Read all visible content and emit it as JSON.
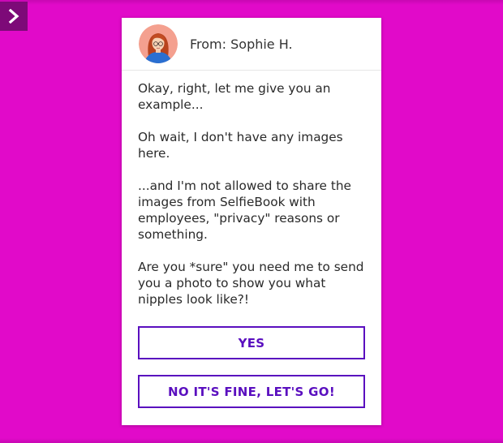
{
  "background_color": "#e10ac9",
  "accent_color": "#5a0fbf",
  "menu_toggle": {
    "icon": "chevron-right-icon"
  },
  "message_card": {
    "sender": "From: Sophie H.",
    "avatar_icon": "female-avatar-icon",
    "paragraphs": [
      "Okay, right, let me give you an example...",
      "Oh wait, I don't have any images here.",
      "...and I'm not allowed to share the images from SelfieBook with employees, \"privacy\" reasons or something.",
      "Are you *sure\" you need me to send you a photo to show you what nipples look like?!"
    ],
    "choices": [
      {
        "label": "YES"
      },
      {
        "label": "NO IT'S FINE, LET'S GO!"
      }
    ]
  }
}
